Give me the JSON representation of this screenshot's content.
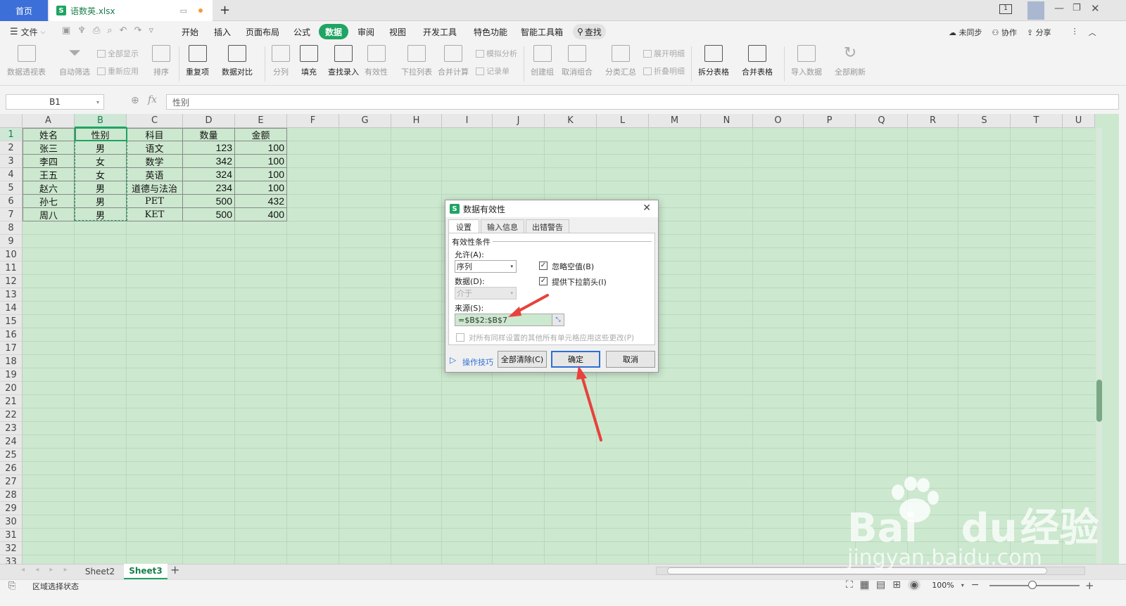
{
  "titlebar": {
    "home_tab": "首页",
    "file_tab": "语数英.xlsx",
    "new_tab": "+"
  },
  "menubar": {
    "file_menu": "文件",
    "items": [
      "开始",
      "插入",
      "页面布局",
      "公式",
      "数据",
      "审阅",
      "视图",
      "开发工具",
      "特色功能",
      "智能工具箱"
    ],
    "active": "数据",
    "search": "查找",
    "sync": "未同步",
    "collab": "协作",
    "share": "分享"
  },
  "ribbon": {
    "buttons": [
      "数据透视表",
      "自动筛选",
      "排序",
      "重复项",
      "数据对比",
      "分列",
      "填充",
      "查找录入",
      "有效性",
      "下拉列表",
      "合并计算",
      "创建组",
      "取消组合",
      "分类汇总",
      "拆分表格",
      "合并表格",
      "导入数据",
      "全部刷新"
    ],
    "small": [
      "全部显示",
      "重新应用",
      "模拟分析",
      "记录单",
      "展开明细",
      "折叠明细"
    ]
  },
  "formula_bar": {
    "cell_ref": "B1",
    "fx": "fx",
    "content": "性别"
  },
  "sheet": {
    "columns": [
      "A",
      "B",
      "C",
      "D",
      "E",
      "F",
      "G",
      "H",
      "I",
      "J",
      "K",
      "L",
      "M",
      "N",
      "O",
      "P",
      "Q",
      "R",
      "S",
      "T",
      "U"
    ],
    "rows": [
      "1",
      "2",
      "3",
      "4",
      "5",
      "6",
      "7",
      "8",
      "9",
      "10",
      "11",
      "12",
      "13",
      "14",
      "15",
      "16",
      "17",
      "18",
      "19",
      "20",
      "21",
      "22",
      "23",
      "24",
      "25",
      "26",
      "27",
      "28",
      "29",
      "30",
      "31",
      "32",
      "33"
    ],
    "header": [
      "姓名",
      "性别",
      "科目",
      "数量",
      "金额"
    ],
    "data": [
      [
        "张三",
        "男",
        "语文",
        "123",
        "100"
      ],
      [
        "李四",
        "女",
        "数学",
        "342",
        "100"
      ],
      [
        "王五",
        "女",
        "英语",
        "324",
        "100"
      ],
      [
        "赵六",
        "男",
        "道德与法治",
        "234",
        "100"
      ],
      [
        "孙七",
        "男",
        "PET",
        "500",
        "432"
      ],
      [
        "周八",
        "男",
        "KET",
        "500",
        "400"
      ]
    ]
  },
  "sheet_tabs": {
    "tabs": [
      "Sheet2",
      "Sheet3"
    ],
    "active": "Sheet3",
    "add": "+"
  },
  "status": {
    "mode": "区域选择状态",
    "zoom": "100%"
  },
  "dialog": {
    "title": "数据有效性",
    "tabs": [
      "设置",
      "输入信息",
      "出错警告"
    ],
    "section": "有效性条件",
    "allow_label": "允许(A):",
    "allow_value": "序列",
    "ignore_blank": "忽略空值(B)",
    "dropdown_arrow": "提供下拉箭头(I)",
    "data_label": "数据(D):",
    "data_value": "介于",
    "source_label": "来源(S):",
    "source_value": "=$B$2:$B$7",
    "apply_all": "对所有同样设置的其他所有单元格应用这些更改(P)",
    "tips": "操作技巧",
    "clear_all": "全部清除(C)",
    "ok": "确定",
    "cancel": "取消"
  },
  "watermark": {
    "brand": "Bai",
    "brand2": "du",
    "cn": "经验",
    "url": "jingyan.baidu.com"
  },
  "colors": {
    "accent": "#1fa463",
    "grid_bg": "#cce8cf",
    "arrow": "#e8413c",
    "tab_home": "#3c6fd8"
  }
}
